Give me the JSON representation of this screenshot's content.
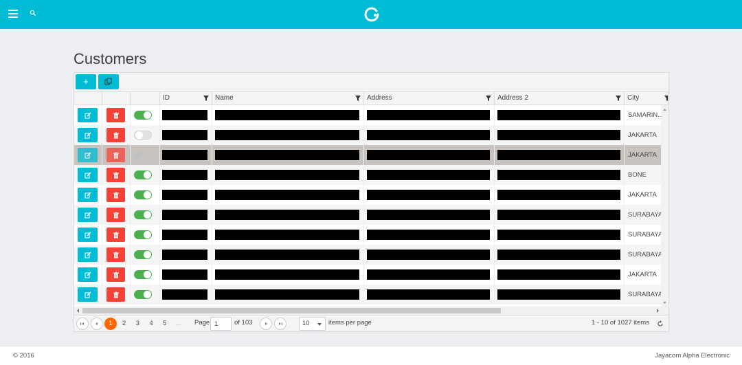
{
  "page": {
    "title": "Customers"
  },
  "toolbar": {
    "add_label": "+",
    "add_icon": "plus-icon",
    "export_icon": "copy-icon"
  },
  "columns": [
    {
      "key": "id",
      "label": "ID",
      "filterable": true
    },
    {
      "key": "name",
      "label": "Name",
      "filterable": true
    },
    {
      "key": "address",
      "label": "Address",
      "filterable": true
    },
    {
      "key": "address2",
      "label": "Address 2",
      "filterable": true
    },
    {
      "key": "city",
      "label": "City",
      "filterable": true
    }
  ],
  "rows": [
    {
      "active": true,
      "city": "SAMARIN..."
    },
    {
      "active": false,
      "city": "JAKARTA"
    },
    {
      "active": null,
      "city": "JAKARTA",
      "selected": true
    },
    {
      "active": true,
      "city": "BONE"
    },
    {
      "active": true,
      "city": "JAKARTA"
    },
    {
      "active": true,
      "city": "SURABAYA"
    },
    {
      "active": true,
      "city": "SURABAYA"
    },
    {
      "active": true,
      "city": "SURABAYA"
    },
    {
      "active": true,
      "city": "JAKARTA"
    },
    {
      "active": true,
      "city": "SURABAYA"
    }
  ],
  "pager": {
    "pages": [
      "1",
      "2",
      "3",
      "4",
      "5",
      "..."
    ],
    "current_page": "1",
    "page_label": "Page",
    "of_label": "of 103",
    "page_size": "10",
    "items_per_page_label": "items per page",
    "summary": "1 - 10 of 1027 items"
  },
  "footer": {
    "copyright": "© 2016",
    "company": "Jayacom Alpha Electronic"
  },
  "colors": {
    "accent": "#00bcd4",
    "danger": "#f44336",
    "toggle_on": "#4caf50",
    "pager_active": "#ff6800"
  }
}
